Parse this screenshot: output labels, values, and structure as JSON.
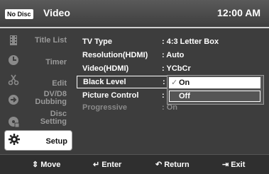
{
  "header": {
    "disc_badge": "No Disc",
    "title": "Video",
    "time": "12:00 AM"
  },
  "sidebar": {
    "items": [
      {
        "label": "Title List",
        "icon": "film-icon"
      },
      {
        "label": "Timer",
        "icon": "clock-icon"
      },
      {
        "label": "Edit",
        "icon": "scissors-icon"
      },
      {
        "label_line1": "DV/D8",
        "label_line2": "Dubbing",
        "icon": "dubbing-icon"
      },
      {
        "label_line1": "Disc",
        "label_line2": "Setting",
        "icon": "disc-icon"
      },
      {
        "label": "Setup",
        "icon": "gear-icon",
        "active": true
      }
    ]
  },
  "settings": [
    {
      "name": "TV Type",
      "value": ": 4:3 Letter Box"
    },
    {
      "name": "Resolution(HDMI)",
      "value": ": Auto"
    },
    {
      "name": "Video(HDMI)",
      "value": ": YCbCr"
    },
    {
      "name": "Black Level",
      "value": ":"
    },
    {
      "name": "Picture Control",
      "value": ":"
    },
    {
      "name": "Progressive",
      "value": ": On"
    }
  ],
  "popup": {
    "options": [
      {
        "label": "On",
        "checked": true
      },
      {
        "label": "Off",
        "checked": false
      }
    ]
  },
  "footer": {
    "move": "Move",
    "enter": "Enter",
    "return": "Return",
    "exit": "Exit"
  }
}
